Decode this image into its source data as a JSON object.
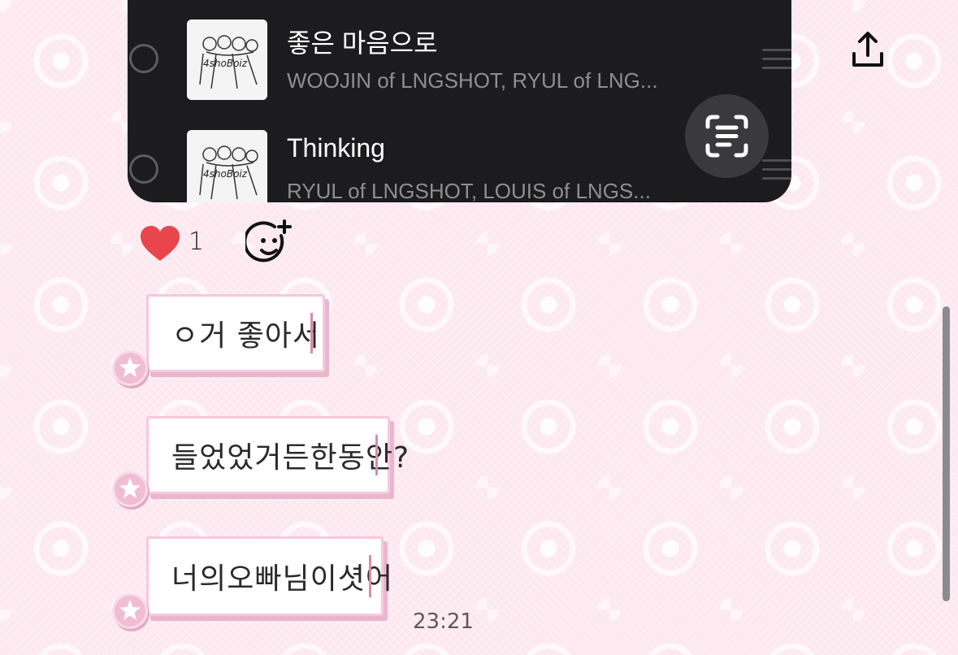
{
  "playlist": {
    "tracks": [
      {
        "title": "좋은 마음으로",
        "artist": "WOOJIN of LNGSHOT, RYUL of LNG...",
        "album_art_text": "4shoBoiz"
      },
      {
        "title": "Thinking",
        "artist": "RYUL of LNGSHOT, LOUIS of LNGS...",
        "album_art_text": "4shoBoiz"
      }
    ]
  },
  "reactions": {
    "heart_count": "1"
  },
  "messages": [
    {
      "text": "ㅇ거 좋아서"
    },
    {
      "text": "들었었거든한동안?"
    },
    {
      "text": "너의오빠님이셧어"
    }
  ],
  "timestamp": "23:21",
  "icons": {
    "share": "share-icon",
    "scan": "live-text-scan-icon",
    "heart": "heart-icon",
    "add_reaction": "add-reaction-icon",
    "reorder": "reorder-icon",
    "star": "star-icon"
  },
  "colors": {
    "card_bg": "#1c1c1e",
    "heart": "#e9454c",
    "bubble_border": "#f6c9dc",
    "background": "#fde8f0"
  }
}
